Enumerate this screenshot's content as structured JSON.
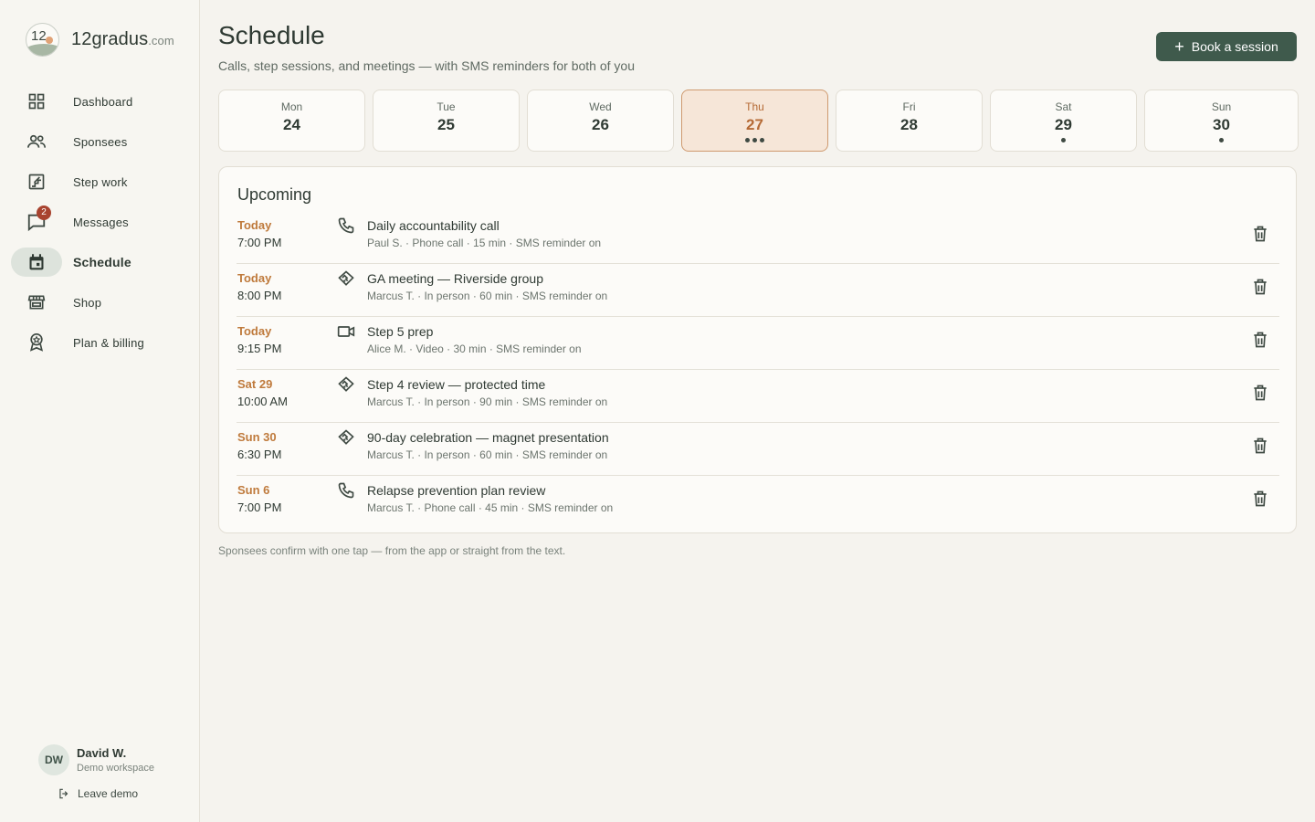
{
  "brand": {
    "name": "12gradus",
    "tld": ".com",
    "logo_number": "12"
  },
  "nav": [
    {
      "key": "dashboard",
      "label": "Dashboard",
      "icon": "grid-icon"
    },
    {
      "key": "sponsees",
      "label": "Sponsees",
      "icon": "people-icon"
    },
    {
      "key": "step-work",
      "label": "Step work",
      "icon": "stairs-icon"
    },
    {
      "key": "messages",
      "label": "Messages",
      "icon": "chat-icon",
      "badge": "2"
    },
    {
      "key": "schedule",
      "label": "Schedule",
      "icon": "calendar-icon",
      "active": true
    },
    {
      "key": "shop",
      "label": "Shop",
      "icon": "storefront-icon"
    },
    {
      "key": "plan-billing",
      "label": "Plan & billing",
      "icon": "award-icon"
    }
  ],
  "user": {
    "initials": "DW",
    "name": "David W.",
    "subtitle": "Demo workspace",
    "leave_label": "Leave demo"
  },
  "header": {
    "title": "Schedule",
    "subtitle": "Calls, step sessions, and meetings — with SMS reminders for both of you",
    "book_label": "Book a session"
  },
  "days": [
    {
      "name": "Mon",
      "num": "24",
      "dots": 0
    },
    {
      "name": "Tue",
      "num": "25",
      "dots": 0
    },
    {
      "name": "Wed",
      "num": "26",
      "dots": 0
    },
    {
      "name": "Thu",
      "num": "27",
      "dots": 3,
      "selected": true
    },
    {
      "name": "Fri",
      "num": "28",
      "dots": 0
    },
    {
      "name": "Sat",
      "num": "29",
      "dots": 1
    },
    {
      "name": "Sun",
      "num": "30",
      "dots": 1
    }
  ],
  "upcoming": {
    "title": "Upcoming",
    "items": [
      {
        "day": "Today",
        "time": "7:00 PM",
        "type": "phone",
        "title": "Daily accountability call",
        "meta": "Paul S. · Phone call · 15 min · SMS reminder on"
      },
      {
        "day": "Today",
        "time": "8:00 PM",
        "type": "in-person",
        "title": "GA meeting — Riverside group",
        "meta": "Marcus T. · In person · 60 min · SMS reminder on"
      },
      {
        "day": "Today",
        "time": "9:15 PM",
        "type": "video",
        "title": "Step 5 prep",
        "meta": "Alice M. · Video · 30 min · SMS reminder on"
      },
      {
        "day": "Sat 29",
        "time": "10:00 AM",
        "type": "in-person",
        "title": "Step 4 review — protected time",
        "meta": "Marcus T. · In person · 90 min · SMS reminder on"
      },
      {
        "day": "Sun 30",
        "time": "6:30 PM",
        "type": "in-person",
        "title": "90-day celebration — magnet presentation",
        "meta": "Marcus T. · In person · 60 min · SMS reminder on"
      },
      {
        "day": "Sun 6",
        "time": "7:00 PM",
        "type": "phone",
        "title": "Relapse prevention plan review",
        "meta": "Marcus T. · Phone call · 45 min · SMS reminder on"
      }
    ]
  },
  "footnote": "Sponsees confirm with one tap — from the app or straight from the text.",
  "colors": {
    "accent": "#3f5a4c",
    "highlight": "#bf7a3c",
    "selected_day_bg": "#f6e6d8",
    "badge": "#a8432f"
  }
}
